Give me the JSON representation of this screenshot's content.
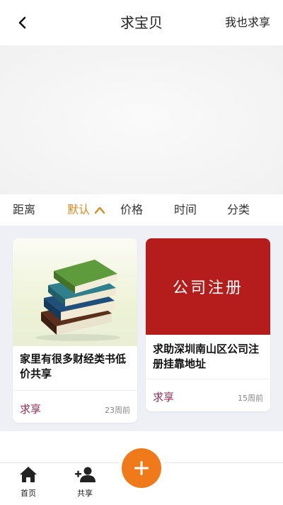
{
  "header": {
    "title": "求宝贝",
    "action_label": "我也求享"
  },
  "sort_tabs": [
    {
      "label": "距离"
    },
    {
      "label": "默认",
      "active": true
    },
    {
      "label": "价格"
    },
    {
      "label": "时间"
    },
    {
      "label": "分类"
    }
  ],
  "cards": [
    {
      "image_icon": "book-stack-image",
      "title": "家里有很多财经类书低价共享",
      "tag": "求享",
      "time": "23周前"
    },
    {
      "image_icon": "company-registration-image",
      "image_text": "公司注册",
      "title": "求助深圳南山区公司注册挂靠地址",
      "tag": "求享",
      "time": "15周前"
    }
  ],
  "tabbar": {
    "home_label": "首页",
    "share_label": "共享",
    "fab_icon": "plus-icon"
  },
  "colors": {
    "accent": "#e0881e",
    "fab": "#f07a1a",
    "tag": "#9a2a4e",
    "banner_red": "#b51d1d"
  }
}
